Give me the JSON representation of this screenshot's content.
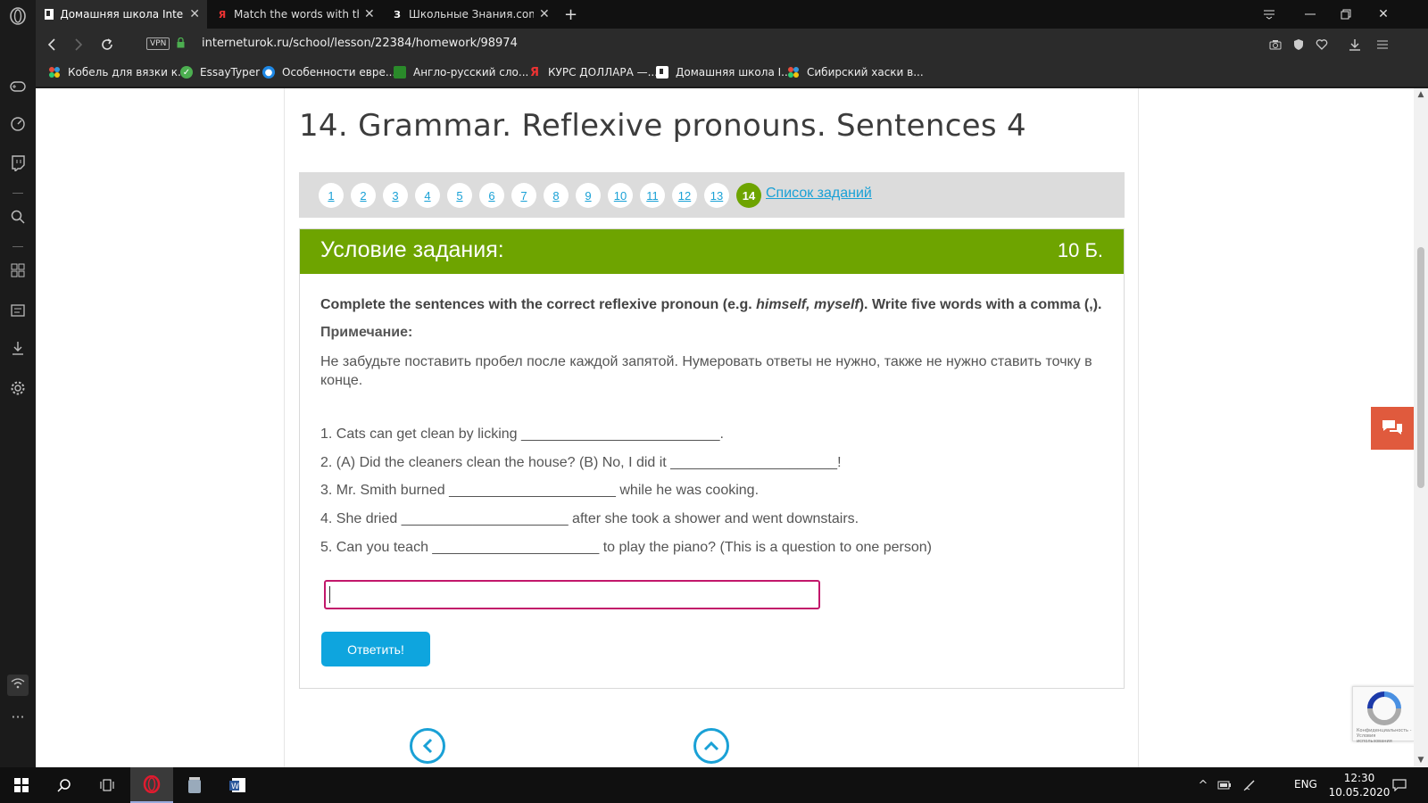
{
  "browser": {
    "tabs": [
      {
        "title": "Домашняя школа InternetUrok",
        "favicon": "I",
        "active": true
      },
      {
        "title": "Match the words with the te",
        "favicon": "Я",
        "active": false
      },
      {
        "title": "Школьные Знания.com - По",
        "favicon": "З",
        "active": false
      }
    ],
    "url": "interneturok.ru/school/lesson/22384/homework/98974",
    "vpn_label": "VPN",
    "bookmarks": [
      {
        "label": "Кобель для вязки к...",
        "icon": "dots-icon"
      },
      {
        "label": "EssayTyper",
        "icon": "check-icon"
      },
      {
        "label": "Особенности евре...",
        "icon": "globe-icon"
      },
      {
        "label": "Англо-русский сло...",
        "icon": "square-icon"
      },
      {
        "label": "КУРС ДОЛЛАРА —...",
        "icon": "yandex-icon"
      },
      {
        "label": "Домашняя школа I...",
        "icon": "bookmark-icon"
      },
      {
        "label": "Сибирский хаски в...",
        "icon": "dots-icon"
      }
    ]
  },
  "lesson": {
    "title": "14. Grammar. Reflexive pronouns. Sentences 4",
    "pages": [
      "1",
      "2",
      "3",
      "4",
      "5",
      "6",
      "7",
      "8",
      "9",
      "10",
      "11",
      "12",
      "13",
      "14"
    ],
    "current_page": "14",
    "task_list_link": "Список заданий"
  },
  "task": {
    "header": "Условие задания:",
    "points": "10 Б.",
    "instruction_pre": "Complete the sentences with the correct reflexive pronoun (e.g. ",
    "instruction_examples": "himself, myself",
    "instruction_post": "). Write five words with a comma (,).",
    "note_label": "Примечание:",
    "note_text": "Не забудьте поставить пробел после каждой запятой. Нумеровать ответы не нужно, также не нужно ставить точку в конце.",
    "sentences": [
      "1. Cats can get clean by licking _________________________.",
      "2. (A) Did the cleaners clean the house? (B) No, I did it _____________________!",
      "3. Mr. Smith burned _____________________ while he was cooking.",
      "4. She dried _____________________ after she took a shower and went downstairs.",
      "5. Can you teach _____________________ to play the piano? (This is a question to one person)"
    ],
    "answer_value": "",
    "submit_label": "Ответить!"
  },
  "recaptcha": {
    "text": "Конфиденциальность - Условия использования"
  },
  "taskbar": {
    "lang": "ENG",
    "time": "12:30",
    "date": "10.05.2020"
  },
  "colors": {
    "accent_green": "#6ea400",
    "link_blue": "#1aa1d6",
    "button_blue": "#0ea5de",
    "input_border": "#c2186b",
    "chat_orange": "#e05a3d"
  }
}
